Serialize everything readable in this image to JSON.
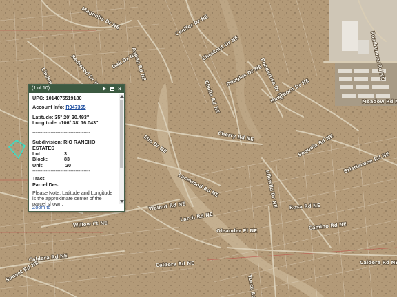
{
  "popup": {
    "counter": "(1 of 10)",
    "upc_label": "UPC:",
    "upc_value": "1014075519180",
    "account_label": "Account Info:",
    "account_value": "R047355",
    "latitude_label": "Latitude:",
    "latitude_value": "35° 20' 20.493\"",
    "longitude_label": "Longitude:",
    "longitude_value": "-106° 38' 16.043\"",
    "separator": "-----------------------------------",
    "subdivision_label": "Subdivision:",
    "subdivision_value_1": "RIO RANCHO",
    "subdivision_value_2": "ESTATES",
    "lot_label": "Lot:",
    "lot_value": "3",
    "block_label": "Block:",
    "block_value": "83",
    "unit_label": "Unit:",
    "unit_value": "20",
    "tract_label": "Tract:",
    "parcel_label": "Parcel Des.:",
    "note": "Please Note: Latitude and Longitude is the approximate center of the parcel shown.",
    "zoom_label": "Zoom to",
    "icons": {
      "next": "play-icon",
      "maximize": "maximize-icon",
      "close": "close-icon"
    }
  },
  "map": {
    "colors": {
      "terrain": "#b39a78",
      "parcel_line": "#e6dccb",
      "road": "#d9cdb5",
      "highlight": "#38e0c8",
      "boundary": "#c04a46"
    },
    "road_labels": [
      {
        "id": "magnolia-dr",
        "text": "Magnolia Dr NE"
      },
      {
        "id": "redwood-dr",
        "text": "Redwood Dr NE"
      },
      {
        "id": "linden-dr",
        "text": "Linden Dr NE"
      },
      {
        "id": "conifer-dr",
        "text": "Conifer Dr NE"
      },
      {
        "id": "chestnut-dr",
        "text": "Chestnut Dr NE"
      },
      {
        "id": "oak-dr",
        "text": "Oak Dr NE"
      },
      {
        "id": "aspen-rd",
        "text": "Aspen Rd NE"
      },
      {
        "id": "douglas-dr",
        "text": "Douglas Dr NE"
      },
      {
        "id": "ponderosa-dr",
        "text": "Ponderosa Dr NE"
      },
      {
        "id": "hawthorn-dr",
        "text": "Hawthorn Dr NE"
      },
      {
        "id": "cholla-rd",
        "text": "Cholla Rd NE"
      },
      {
        "id": "cherry-rd",
        "text": "Cherry Rd NE"
      },
      {
        "id": "sequoia-rd",
        "text": "Sequoia Rd NE"
      },
      {
        "id": "bristlecone-rd",
        "text": "Bristlecone Rd NE"
      },
      {
        "id": "lacewood-rd",
        "text": "Lacewood Rd NE"
      },
      {
        "id": "oleander-pl",
        "text": "Oleander Pl NE"
      },
      {
        "id": "caldera-rd-1",
        "text": "Caldera Rd NE"
      },
      {
        "id": "caldera-rd-2",
        "text": "Caldera Rd NE"
      },
      {
        "id": "caldera-rd-3",
        "text": "Caldera Rd NE"
      },
      {
        "id": "willow-ct",
        "text": "Willow Ct NE"
      },
      {
        "id": "walnut-rd",
        "text": "Walnut Rd NE"
      },
      {
        "id": "larch-rd",
        "text": "Larch Rd NE"
      },
      {
        "id": "elm-dr",
        "text": "Elm Dr NE"
      },
      {
        "id": "rosa-st",
        "text": "Rosa Rd NE"
      },
      {
        "id": "camino-rd",
        "text": "Camino Rd NE"
      },
      {
        "id": "idlewild-dr",
        "text": "Idlewild Dr NE"
      },
      {
        "id": "sunset-rd",
        "text": "Sunset Rd NE"
      },
      {
        "id": "yucca-rd",
        "text": "Yucca Rd NE"
      },
      {
        "id": "meadow-rd",
        "text": "Meadow Rd NE"
      },
      {
        "id": "roadrunner-rd",
        "text": "Roadrunner Rd NE"
      }
    ]
  }
}
